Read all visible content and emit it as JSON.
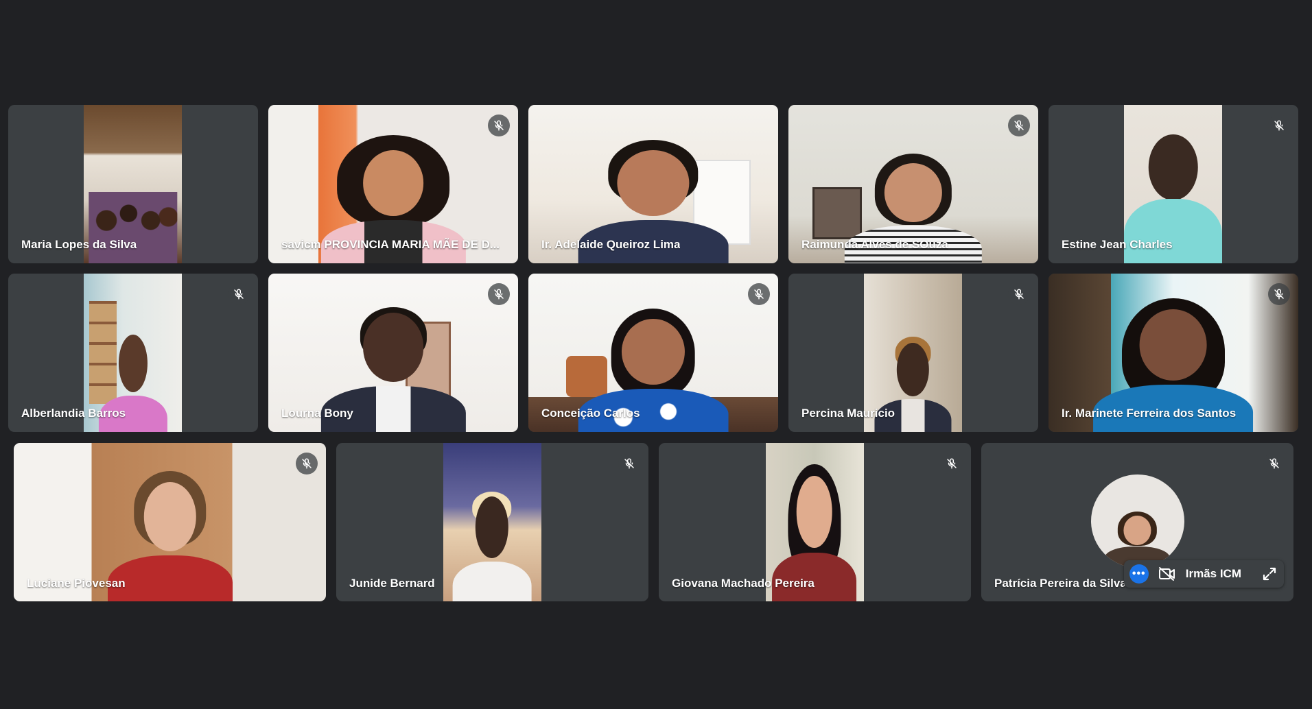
{
  "colors": {
    "background": "#202124",
    "tile": "#3c4043",
    "accent": "#1a73e8"
  },
  "participants": [
    {
      "name": "Maria Lopes da Silva",
      "muted": false
    },
    {
      "name": "savicm PROVINCIA MARIA MÃE DE D...",
      "muted": true
    },
    {
      "name": "Ir. Adelaide Queiroz Lima",
      "muted": false
    },
    {
      "name": "Raimunda Alves de SOuza",
      "muted": true
    },
    {
      "name": "Estine Jean Charles",
      "muted": true
    },
    {
      "name": "Alberlandia Barros",
      "muted": true
    },
    {
      "name": "Lourna Bony",
      "muted": true
    },
    {
      "name": "Conceição Carlos",
      "muted": true
    },
    {
      "name": "Percina Mauricio",
      "muted": true
    },
    {
      "name": "Ir. Marinete Ferreira dos Santos",
      "muted": true
    },
    {
      "name": "Luciane Piovesan",
      "muted": true
    },
    {
      "name": "Junide Bernard",
      "muted": true
    },
    {
      "name": "Giovana Machado Pereira",
      "muted": true
    },
    {
      "name": "Patrícia Pereira da Silva",
      "muted": true
    }
  ],
  "self_view": {
    "label": "Irmãs ICM",
    "more_icon": "more-options-icon",
    "camera_icon": "camera-off-icon",
    "expand_icon": "expand-icon"
  }
}
